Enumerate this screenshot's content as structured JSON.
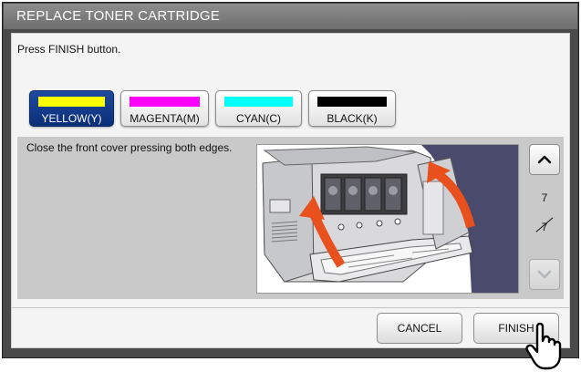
{
  "dialog": {
    "title": "REPLACE TONER CARTRIDGE",
    "instruction": "Press FINISH button."
  },
  "color_tabs": [
    {
      "label": "YELLOW(Y)",
      "swatch_color": "#ffff00",
      "selected": true
    },
    {
      "label": "MAGENTA(M)",
      "swatch_color": "#ff00ff",
      "selected": false
    },
    {
      "label": "CYAN(C)",
      "swatch_color": "#00ffff",
      "selected": false
    },
    {
      "label": "BLACK(K)",
      "swatch_color": "#000000",
      "selected": false
    }
  ],
  "step": {
    "text": "Close the front cover pressing both edges.",
    "illustration": "printer-front-cover-closing",
    "current_page": "7",
    "total_pages": "7"
  },
  "scroll": {
    "up_icon": "chevron-up-icon",
    "down_icon": "chevron-down-icon",
    "down_enabled": false
  },
  "actions": {
    "cancel_label": "CANCEL",
    "finish_label": "FINISH"
  },
  "colors": {
    "selected_tab": "#0b2f78",
    "arrow_accent": "#e8501e",
    "title_bar": "#7a7a7a"
  }
}
